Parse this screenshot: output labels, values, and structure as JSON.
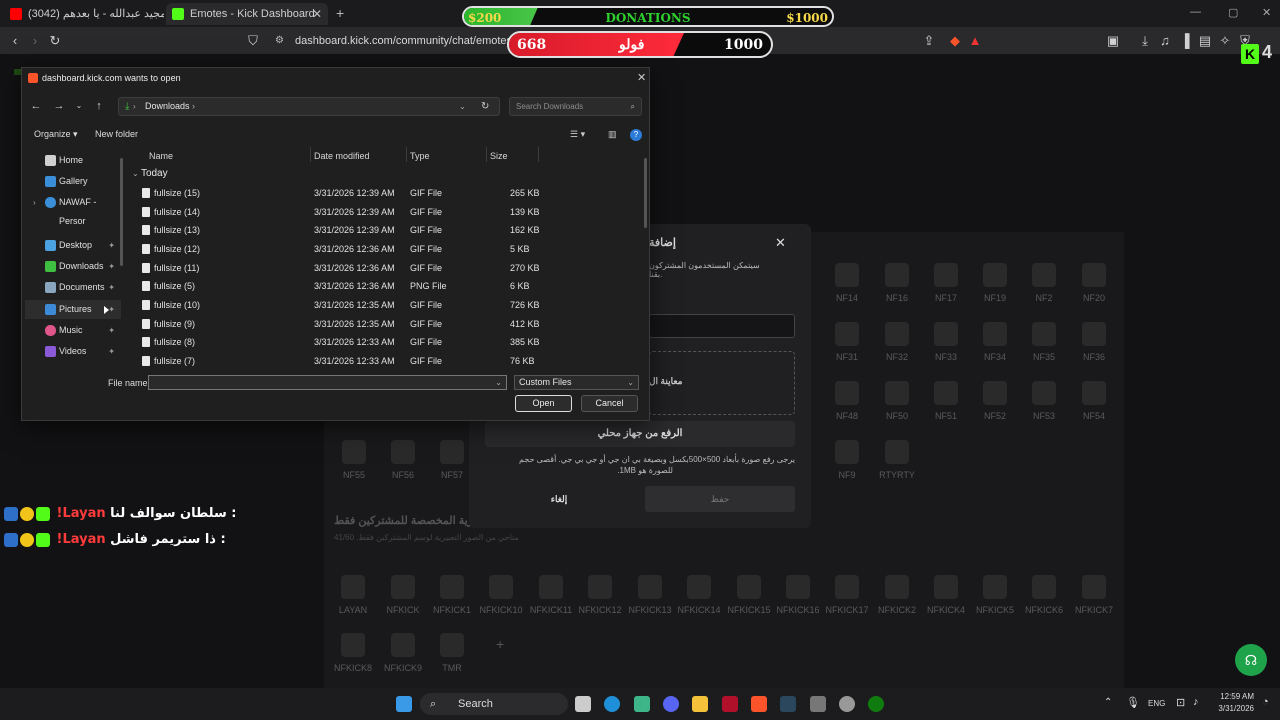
{
  "browser": {
    "tabs": [
      {
        "label": "(3042) عبدالمجيد عبدالله - يا بعدهم",
        "active": false
      },
      {
        "label": "Emotes - Kick Dashboard",
        "active": true
      }
    ],
    "new_tab": "+",
    "url": "dashboard.kick.com/community/chat/emotes"
  },
  "overlays": {
    "donations": {
      "min": "$200",
      "label": "DONATIONS",
      "max": "$1000",
      "progress_fraction": 0.2
    },
    "follows": {
      "current": "668",
      "label": "فولو",
      "goal": "1000",
      "progress_fraction": 0.668
    },
    "channel_badge_number": "4"
  },
  "dialog": {
    "title": "dashboard.kick.com wants to open",
    "path": "Downloads",
    "search_placeholder": "Search Downloads",
    "organize": "Organize",
    "new_folder": "New folder",
    "sidebar": [
      {
        "label": "Home",
        "icon": "home-icon",
        "pinned": false
      },
      {
        "label": "Gallery",
        "icon": "gallery-icon",
        "pinned": false
      },
      {
        "label": "NAWAF - Persor",
        "icon": "cloud-icon",
        "pinned": false
      },
      {
        "label": "Desktop",
        "icon": "desktop-icon",
        "pinned": true
      },
      {
        "label": "Downloads",
        "icon": "download-icon",
        "pinned": true
      },
      {
        "label": "Documents",
        "icon": "documents-icon",
        "pinned": true
      },
      {
        "label": "Pictures",
        "icon": "pictures-icon",
        "pinned": true
      },
      {
        "label": "Music",
        "icon": "music-icon",
        "pinned": true
      },
      {
        "label": "Videos",
        "icon": "videos-icon",
        "pinned": true
      }
    ],
    "columns": {
      "name": "Name",
      "date": "Date modified",
      "type": "Type",
      "size": "Size"
    },
    "group": "Today",
    "files": [
      {
        "name": "fullsize (15)",
        "date": "3/31/2026 12:39 AM",
        "type": "GIF File",
        "size": "265 KB"
      },
      {
        "name": "fullsize (14)",
        "date": "3/31/2026 12:39 AM",
        "type": "GIF File",
        "size": "139 KB"
      },
      {
        "name": "fullsize (13)",
        "date": "3/31/2026 12:39 AM",
        "type": "GIF File",
        "size": "162 KB"
      },
      {
        "name": "fullsize (12)",
        "date": "3/31/2026 12:36 AM",
        "type": "GIF File",
        "size": "5 KB"
      },
      {
        "name": "fullsize (11)",
        "date": "3/31/2026 12:36 AM",
        "type": "GIF File",
        "size": "270 KB"
      },
      {
        "name": "fullsize (5)",
        "date": "3/31/2026 12:36 AM",
        "type": "PNG File",
        "size": "6 KB"
      },
      {
        "name": "fullsize (10)",
        "date": "3/31/2026 12:35 AM",
        "type": "GIF File",
        "size": "726 KB"
      },
      {
        "name": "fullsize (9)",
        "date": "3/31/2026 12:35 AM",
        "type": "GIF File",
        "size": "412 KB"
      },
      {
        "name": "fullsize (8)",
        "date": "3/31/2026 12:33 AM",
        "type": "GIF File",
        "size": "385 KB"
      },
      {
        "name": "fullsize (7)",
        "date": "3/31/2026 12:33 AM",
        "type": "GIF File",
        "size": "76 KB"
      }
    ],
    "file_name_label": "File name:",
    "file_name_value": "",
    "file_type": "Custom Files",
    "open": "Open",
    "cancel": "Cancel"
  },
  "modal": {
    "title": "إضافة",
    "description": "سيتمكن المستخدمون المشتركون بقنا.",
    "preview": "معاينة ال",
    "upload_local": "الرفع من جهاز محلي",
    "upload_hint_1": "يرجى رفع صورة بأبعاد 500×500بكسل وبصيغة بي ان جي أو جي بي جي. أقصى حجم",
    "upload_hint_2": "للصورة هو 1MB.",
    "cancel": "إلغاء",
    "save": "حفظ"
  },
  "emotes_grid_top": [
    {
      "label": "NF14"
    },
    {
      "label": "NF16"
    },
    {
      "label": "NF17"
    },
    {
      "label": "NF19"
    },
    {
      "label": "NF2"
    },
    {
      "label": "NF20"
    },
    {
      "label": "NF31"
    },
    {
      "label": "NF32"
    },
    {
      "label": "NF33"
    },
    {
      "label": "NF34"
    },
    {
      "label": "NF35"
    },
    {
      "label": "NF36"
    },
    {
      "label": "NF48"
    },
    {
      "label": "NF50"
    },
    {
      "label": "NF51"
    },
    {
      "label": "NF52"
    },
    {
      "label": "NF53"
    },
    {
      "label": "NF54"
    },
    {
      "label": "NF9"
    },
    {
      "label": "RTYRTY"
    }
  ],
  "emotes_grid_left": [
    {
      "label": "NF55"
    },
    {
      "label": "NF56"
    },
    {
      "label": "NF57"
    }
  ],
  "subscriber_section": {
    "title": "التعبيرية المخصصة للمشتركين فقط",
    "subtitle": "متاحي من الصور التعبيرية لوسم المشتركين فقط. 41/60"
  },
  "emotes_sub": [
    {
      "label": "LAYAN"
    },
    {
      "label": "NFKICK"
    },
    {
      "label": "NFKICK1"
    },
    {
      "label": "NFKICK10"
    },
    {
      "label": "NFKICK11"
    },
    {
      "label": "NFKICK12"
    },
    {
      "label": "NFKICK13"
    },
    {
      "label": "NFKICK14"
    },
    {
      "label": "NFKICK15"
    },
    {
      "label": "NFKICK16"
    },
    {
      "label": "NFKICK17"
    },
    {
      "label": "NFKICK2"
    },
    {
      "label": "NFKICK4"
    },
    {
      "label": "NFKICK5"
    },
    {
      "label": "NFKICK6"
    },
    {
      "label": "NFKICK7"
    },
    {
      "label": "NFKICK8"
    },
    {
      "label": "NFKICK9"
    },
    {
      "label": "TMR"
    }
  ],
  "chat": [
    {
      "user": "!Layan",
      "message": "سلطان سوالف لنا :"
    },
    {
      "user": "!Layan",
      "message": "ذا ستريمر فاشل :"
    }
  ],
  "taskbar": {
    "search": "Search",
    "lang": "ENG",
    "time": "12:59 AM",
    "date": "3/31/2026"
  },
  "colors": {
    "kick_green": "#53fc18",
    "chat_user": "#ff3b3b"
  }
}
